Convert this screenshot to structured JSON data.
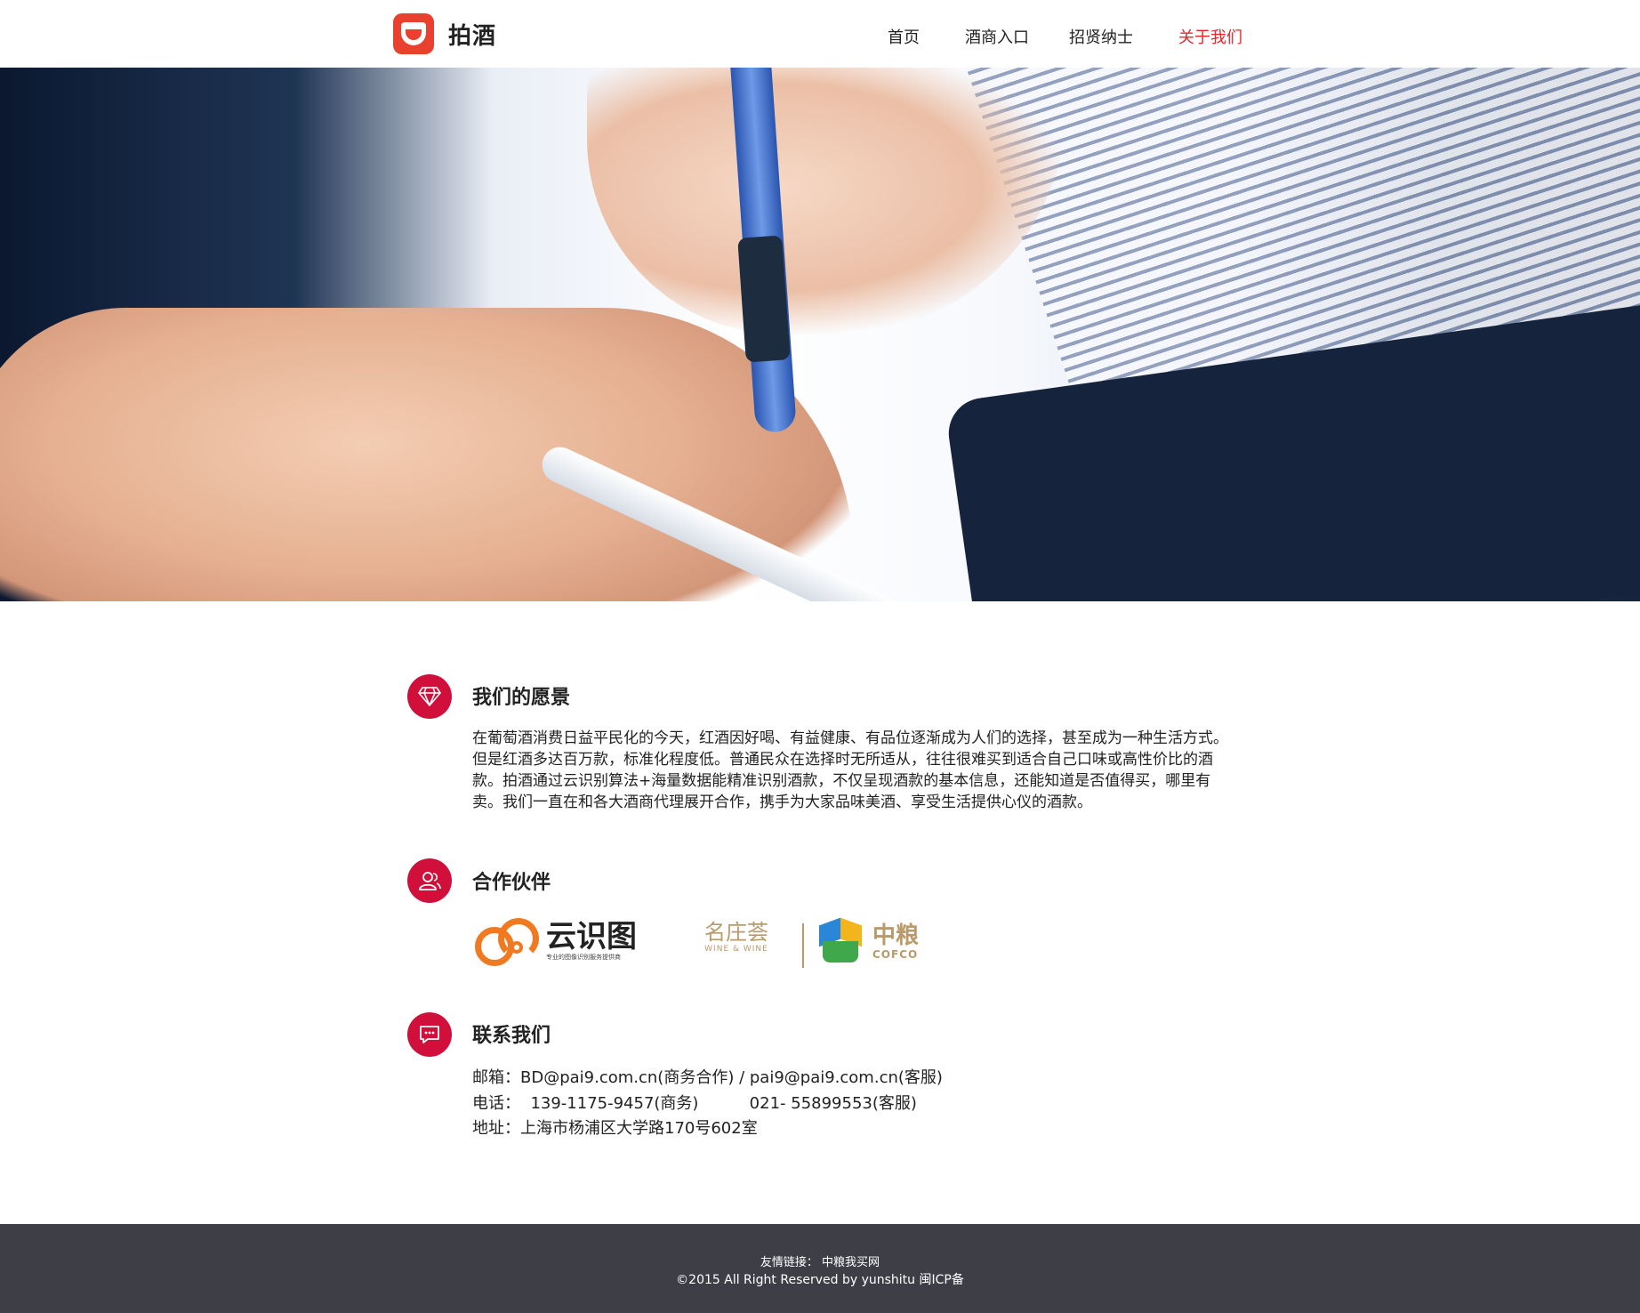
{
  "header": {
    "logo_text": "拍酒",
    "nav": [
      "首页",
      "酒商入口",
      "招贤纳士",
      "关于我们"
    ],
    "active_nav": "关于我们",
    "accent_color": "#e4262b"
  },
  "sections": {
    "vision": {
      "icon": "diamond-icon",
      "title": "我们的愿景",
      "text": "在葡萄酒消费日益平民化的今天，红酒因好喝、有益健康、有品位逐渐成为人们的选择，甚至成为一种生活方式。但是红酒多达百万款，标准化程度低。普通民众在选择时无所适从，往往很难买到适合自己口味或高性价比的酒款。拍酒通过云识别算法+海量数据能精准识别酒款，不仅呈现酒款的基本信息，还能知道是否值得买，哪里有卖。我们一直在和各大酒商代理展开合作，携手为大家品味美酒、享受生活提供心仪的酒款。"
    },
    "partners": {
      "icon": "people-icon",
      "title": "合作伙伴",
      "yunshitu_name": "云识图",
      "yunshitu_sub": "专业的图像识别服务提供商",
      "mingzhuang_name": "名庄荟",
      "mingzhuang_en": "WINE & WINE",
      "cofco_cn": "中粮",
      "cofco_en": "COFCO"
    },
    "contact": {
      "icon": "chat-icon",
      "title": "联系我们",
      "email": "邮箱：BD@pai9.com.cn(商务合作) / pai9@pai9.com.cn(客服)",
      "phone": "电话：  139-1175-9457(商务)          021- 55899553(客服)",
      "address": "地址：上海市杨浦区大学路170号602室"
    }
  },
  "footer": {
    "links": "友情链接：  中粮我买网",
    "copyright": "©2015 All Right Reserved by yunshitu 闽ICP备"
  },
  "colors": {
    "icon_bg": "#d0103a",
    "footer_bg": "#3e3f46"
  }
}
